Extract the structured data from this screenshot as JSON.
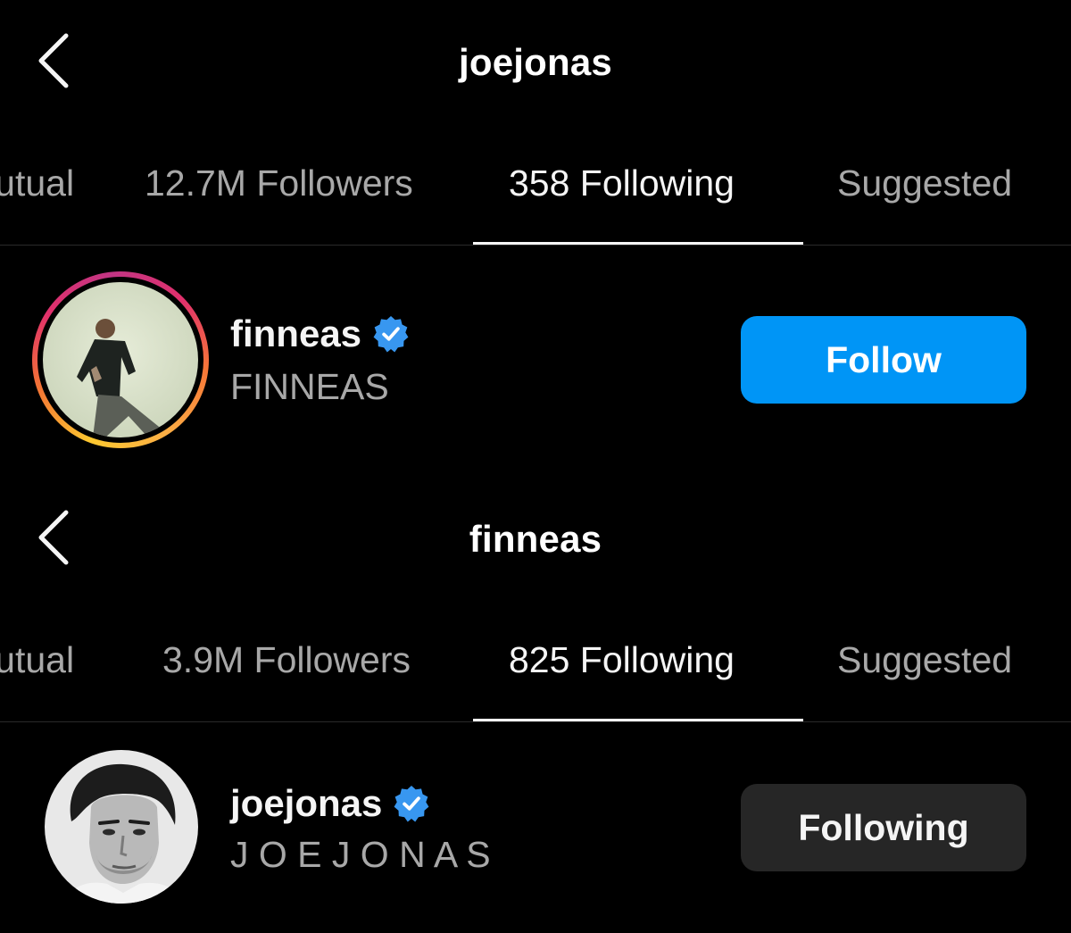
{
  "screens": [
    {
      "header": {
        "title": "joejonas",
        "back_icon": "chevron-left-icon"
      },
      "tabs": [
        {
          "label": "Mutual",
          "active": false
        },
        {
          "label": "12.7M Followers",
          "active": false
        },
        {
          "label": "358 Following",
          "active": true
        },
        {
          "label": "Suggested",
          "active": false
        }
      ],
      "user": {
        "username": "finneas",
        "full_name": "FINNEAS",
        "verified_icon": "verified-badge-icon",
        "has_story_ring": true,
        "button_label": "Follow"
      }
    },
    {
      "header": {
        "title": "finneas",
        "back_icon": "chevron-left-icon"
      },
      "tabs": [
        {
          "label": "Mutual",
          "active": false
        },
        {
          "label": "3.9M Followers",
          "active": false
        },
        {
          "label": "825 Following",
          "active": true
        },
        {
          "label": "Suggested",
          "active": false
        }
      ],
      "user": {
        "username": "joejonas",
        "full_name": "J O E J O N A S",
        "verified_icon": "verified-badge-icon",
        "has_story_ring": false,
        "button_label": "Following"
      }
    }
  ],
  "colors": {
    "background": "#000000",
    "primary_text": "#f5f5f5",
    "secondary_text": "#a8a8a8",
    "follow_button": "#0095f6",
    "following_button": "#262626",
    "verified_badge": "#3897f0"
  }
}
